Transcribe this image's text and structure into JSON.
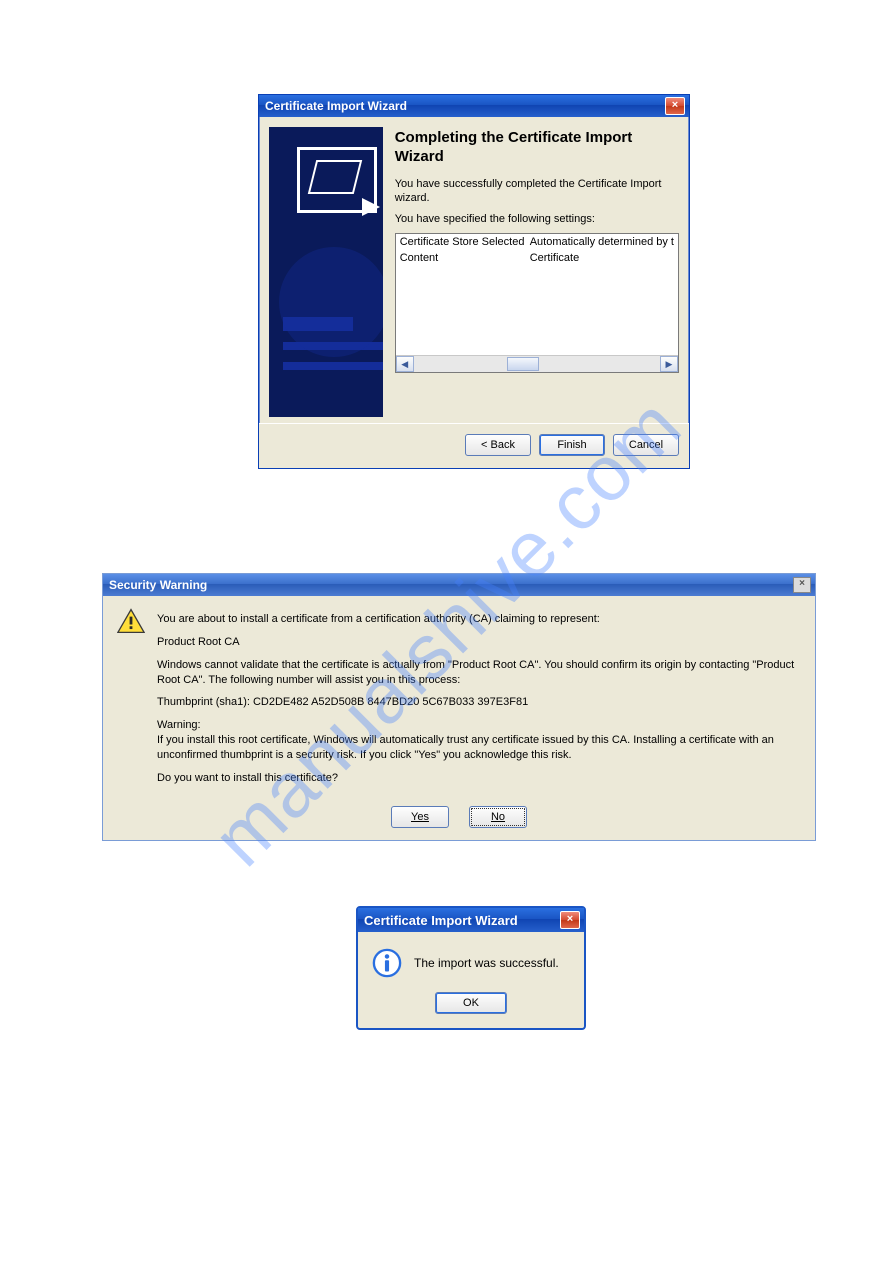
{
  "watermark": "manualshive.com",
  "wizard": {
    "title": "Certificate Import Wizard",
    "heading": "Completing the Certificate Import Wizard",
    "line1": "You have successfully completed the Certificate Import wizard.",
    "line2": "You have specified the following settings:",
    "settings": [
      {
        "label": "Certificate Store Selected",
        "value": "Automatically determined by t"
      },
      {
        "label": "Content",
        "value": "Certificate"
      }
    ],
    "buttons": {
      "back": "< Back",
      "finish": "Finish",
      "cancel": "Cancel"
    }
  },
  "security": {
    "title": "Security Warning",
    "p1": "You are about to install a certificate from a certification authority (CA) claiming to represent:",
    "p2": "Product Root CA",
    "p3": "Windows cannot validate that the certificate is actually from \"Product Root CA\". You should confirm its origin by contacting \"Product Root CA\". The following number will assist you in this process:",
    "p4": "Thumbprint (sha1): CD2DE482 A52D508B 8447BD20 5C67B033 397E3F81",
    "p5a": "Warning:",
    "p5b": "If you install this root certificate, Windows will automatically trust any certificate issued by this CA. Installing a certificate with an unconfirmed thumbprint is a security risk. If you click \"Yes\" you acknowledge this risk.",
    "p6": "Do you want to install this certificate?",
    "buttons": {
      "yes": "Yes",
      "no": "No"
    }
  },
  "success": {
    "title": "Certificate Import Wizard",
    "message": "The import was successful.",
    "buttons": {
      "ok": "OK"
    }
  }
}
